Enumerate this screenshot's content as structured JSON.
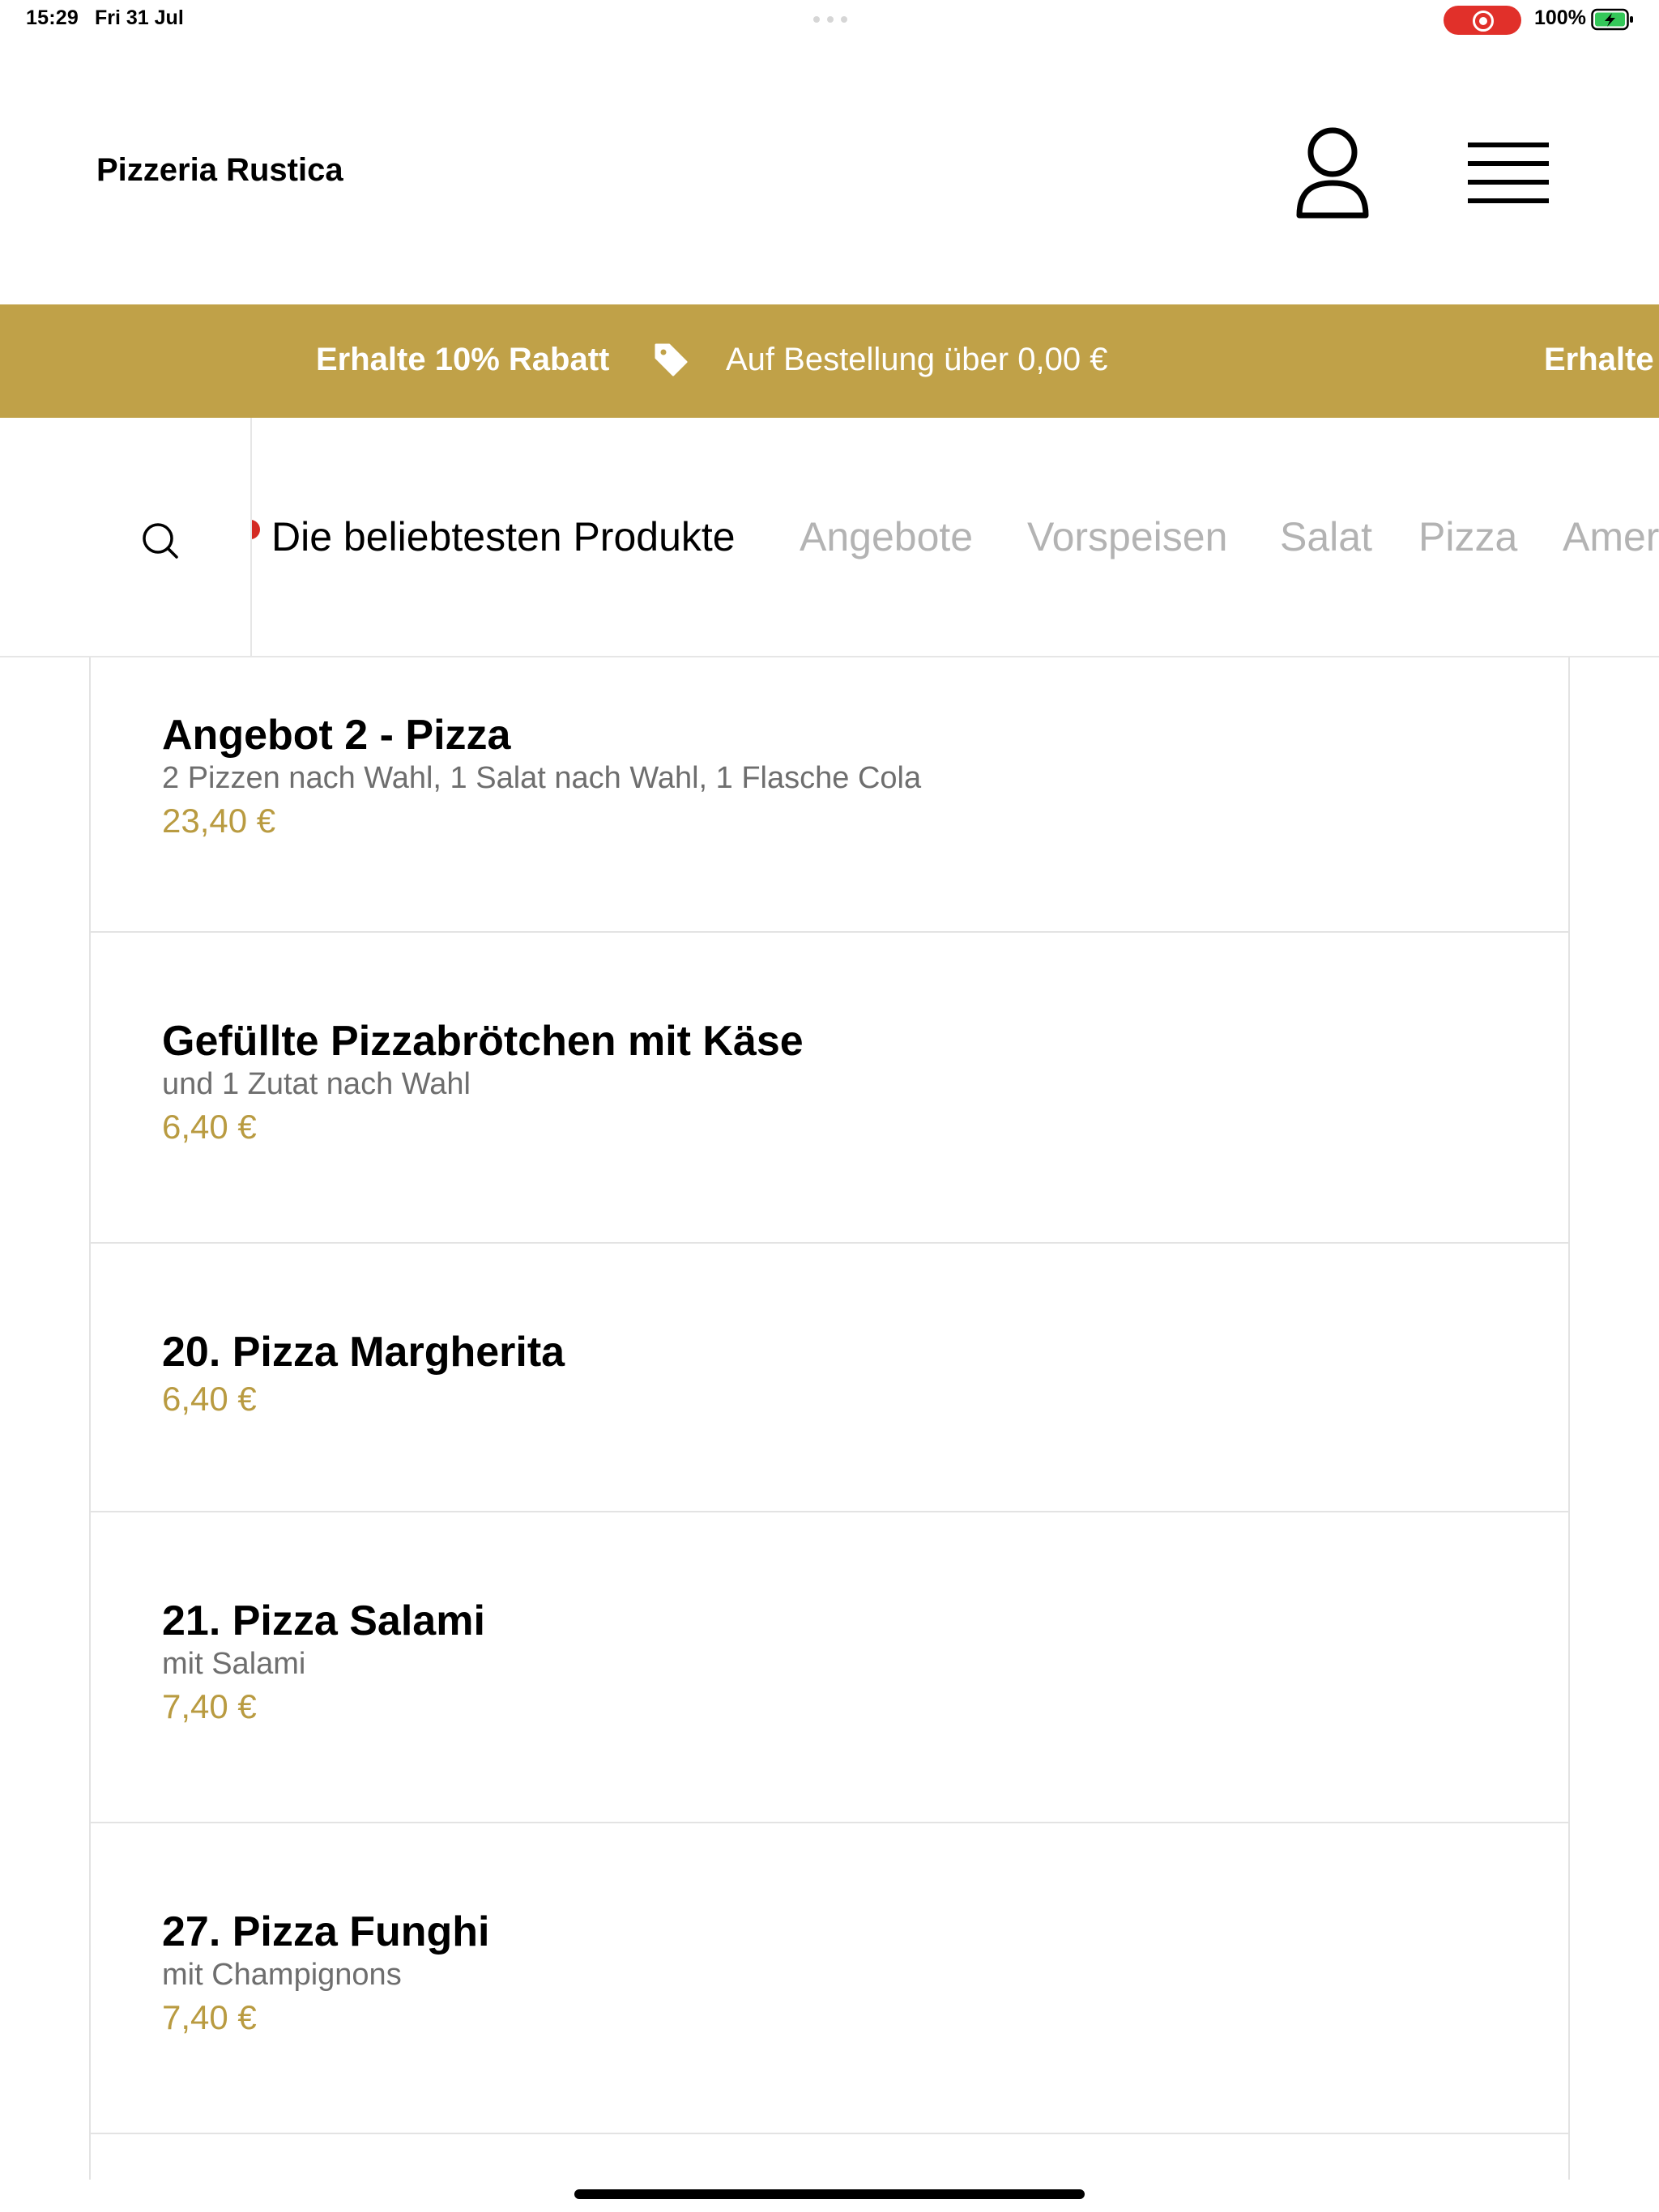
{
  "status_bar": {
    "time": "15:29",
    "date": "Fri 31 Jul",
    "battery": "100%",
    "recording_color": "#e1302a",
    "battery_color": "#34c759"
  },
  "header": {
    "brand": "Pizzeria Rustica",
    "user_icon": "user-icon",
    "menu_icon": "hamburger-menu-icon"
  },
  "promo": {
    "title": "Erhalte 10% Rabatt",
    "subtitle": "Auf Bestellung über 0,00 €",
    "title_repeat": "Erhalte",
    "background": "#c0a148",
    "icon": "tag-icon"
  },
  "categories": {
    "search_icon": "search-icon",
    "tabs": [
      {
        "label": "Die beliebtesten Produkte",
        "active": true
      },
      {
        "label": "Angebote",
        "active": false
      },
      {
        "label": "Vorspeisen",
        "active": false
      },
      {
        "label": "Salat",
        "active": false
      },
      {
        "label": "Pizza",
        "active": false
      },
      {
        "label": "Amer",
        "active": false
      }
    ]
  },
  "products": [
    {
      "name": "Angebot 2 - Pizza",
      "description": "2 Pizzen nach Wahl, 1 Salat nach Wahl, 1 Flasche Cola",
      "price": "23,40 €"
    },
    {
      "name": "Gefüllte Pizzabrötchen mit Käse",
      "description": "und 1 Zutat nach Wahl",
      "price": "6,40 €"
    },
    {
      "name": "20. Pizza Margherita",
      "description": "",
      "price": "6,40 €"
    },
    {
      "name": "21. Pizza Salami",
      "description": "mit Salami",
      "price": "7,40 €"
    },
    {
      "name": "27. Pizza Funghi",
      "description": "mit Champignons",
      "price": "7,40 €"
    }
  ],
  "price_color": "#b99b41"
}
